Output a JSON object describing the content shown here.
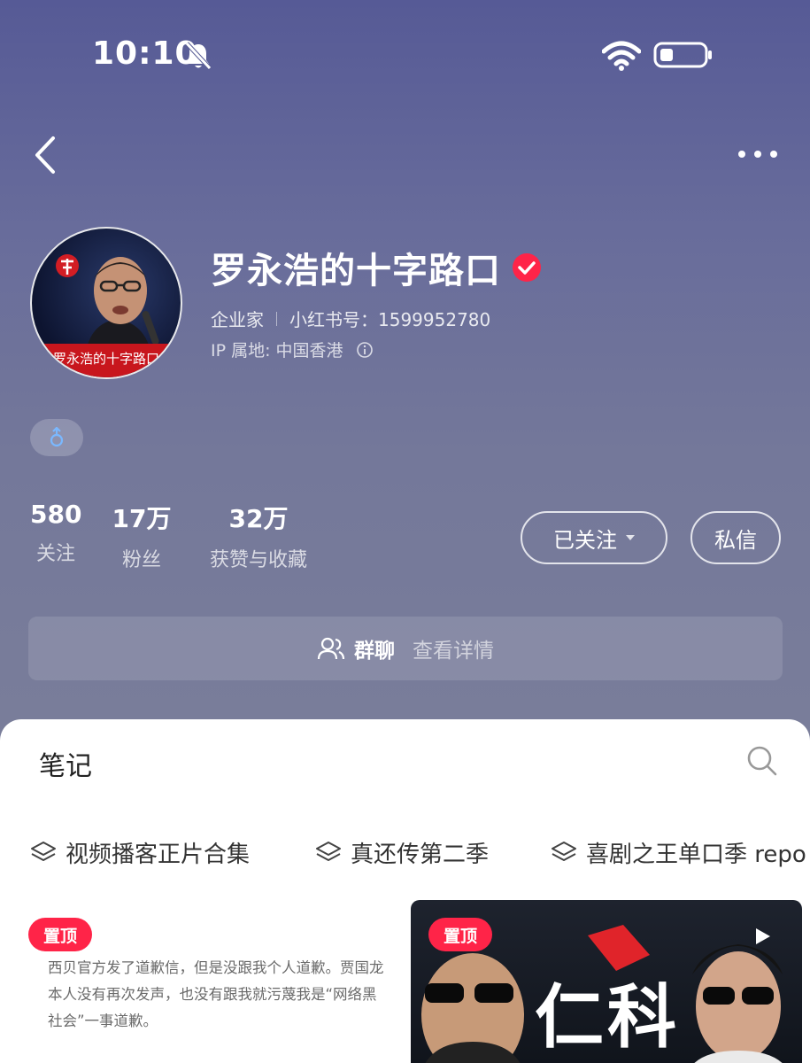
{
  "status_bar": {
    "time": "10:10"
  },
  "profile": {
    "avatar_banner_text": "罗永浩的十字路口",
    "name": "罗永浩的十字路口",
    "occupation": "企业家",
    "id_label": "小红书号：1599952780",
    "ip_location": "IP 属地: 中国香港"
  },
  "stats": [
    {
      "value": "580",
      "label": "关注"
    },
    {
      "value": "17万",
      "label": "粉丝"
    },
    {
      "value": "32万",
      "label": "获赞与收藏"
    }
  ],
  "actions": {
    "follow_label": "已关注",
    "message_label": "私信"
  },
  "group_chat": {
    "title": "群聊",
    "detail": "查看详情"
  },
  "notes": {
    "title": "笔记",
    "collections": [
      "视频播客正片合集",
      "真还传第二季",
      "喜剧之王单口季 repo"
    ],
    "pinned_label": "置顶",
    "card_text": "西贝官方发了道歉信，但是没跟我个人道歉。贾国龙本人没有再次发声，也没有跟我就污蔑我是“网络黑社会”一事道歉。",
    "video_title": "仁科"
  },
  "colors": {
    "accent": "#ff2448",
    "header_bg": "#686c9b"
  }
}
